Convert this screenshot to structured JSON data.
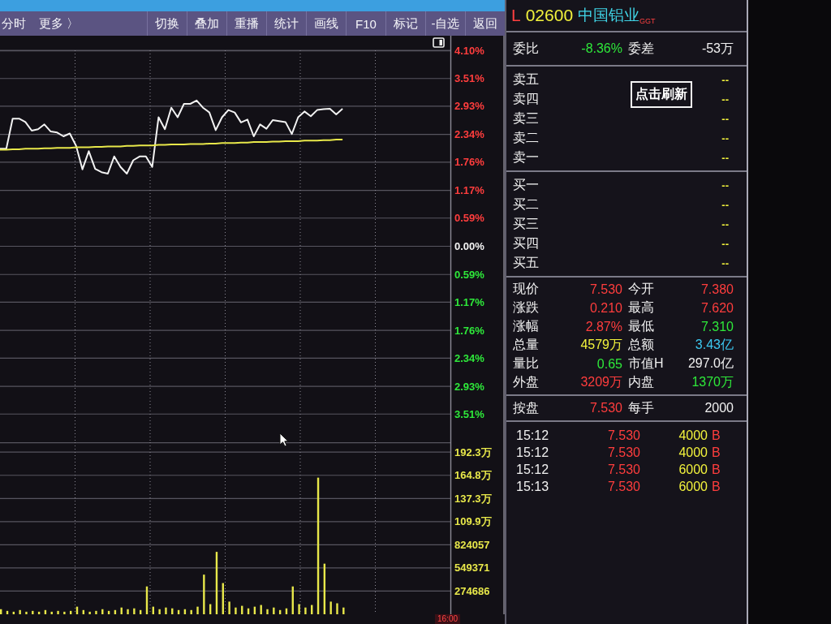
{
  "toolbar": {
    "left_items": [
      "分时",
      "更多 〉"
    ],
    "buttons": [
      "切换",
      "叠加",
      "重播",
      "统计",
      "画线",
      "F10",
      "标记",
      "-自选",
      "返回"
    ]
  },
  "chart_panel": {
    "chart_data": [
      {
        "type": "line",
        "categories": [
          null,
          null,
          null,
          null,
          null,
          null,
          null,
          null,
          null,
          null,
          null,
          null,
          null,
          null,
          null,
          null,
          null,
          null,
          null,
          null,
          null,
          null,
          null,
          null,
          null,
          null,
          null,
          null,
          null,
          null,
          null,
          null,
          null,
          null,
          null,
          null,
          null,
          null,
          null,
          null,
          null,
          null,
          null,
          null,
          null,
          null,
          null,
          null,
          null,
          null,
          null,
          null,
          null,
          null,
          null,
          null,
          null,
          null,
          null,
          null,
          null,
          null,
          null,
          null,
          null,
          null,
          null,
          null,
          null,
          null,
          null,
          null
        ],
        "ylim": [
          -4.1,
          4.1
        ],
        "yticks": [
          {
            "value": 4.1,
            "label": "4.10%"
          },
          {
            "value": 3.51,
            "label": "3.51%"
          },
          {
            "value": 2.93,
            "label": "2.93%"
          },
          {
            "value": 2.34,
            "label": "2.34%"
          },
          {
            "value": 1.76,
            "label": "1.76%"
          },
          {
            "value": 1.17,
            "label": "1.17%"
          },
          {
            "value": 0.59,
            "label": "0.59%"
          },
          {
            "value": 0,
            "label": "0.00%"
          },
          {
            "value": -0.59,
            "label": "0.59%"
          },
          {
            "value": -1.17,
            "label": "1.17%"
          },
          {
            "value": -1.76,
            "label": "1.76%"
          },
          {
            "value": -2.34,
            "label": "2.34%"
          },
          {
            "value": -2.93,
            "label": "2.93%"
          },
          {
            "value": -3.51,
            "label": "3.51%"
          }
        ],
        "grid": true,
        "series": [
          {
            "color": "#f2f2f2",
            "values": [
              2.04,
              2.04,
              2.67,
              2.67,
              2.6,
              2.42,
              2.45,
              2.55,
              2.4,
              2.38,
              2.3,
              2.36,
              2.1,
              1.61,
              1.99,
              1.62,
              1.55,
              1.52,
              1.88,
              1.66,
              1.52,
              1.8,
              1.88,
              1.88,
              1.66,
              2.7,
              2.45,
              2.9,
              2.7,
              2.98,
              2.98,
              3.05,
              2.9,
              2.8,
              2.43,
              2.7,
              2.85,
              2.8,
              2.59,
              2.65,
              2.3,
              2.55,
              2.46,
              2.64,
              2.62,
              2.6,
              2.35,
              2.7,
              2.82,
              2.72,
              2.85,
              2.87,
              2.88,
              2.76,
              2.88,
              null,
              null,
              null,
              null,
              null,
              null,
              null,
              null,
              null,
              null,
              null,
              null,
              null,
              null,
              null,
              null,
              null
            ]
          },
          {
            "color": "#e8e84a",
            "values": [
              2.02,
              2.02,
              2.03,
              2.03,
              2.04,
              2.04,
              2.04,
              2.05,
              2.05,
              2.06,
              2.06,
              2.06,
              2.07,
              2.07,
              2.07,
              2.08,
              2.08,
              2.09,
              2.09,
              2.09,
              2.1,
              2.1,
              2.11,
              2.11,
              2.11,
              2.12,
              2.12,
              2.13,
              2.13,
              2.13,
              2.14,
              2.14,
              2.14,
              2.15,
              2.15,
              2.16,
              2.16,
              2.16,
              2.17,
              2.17,
              2.18,
              2.18,
              2.18,
              2.19,
              2.19,
              2.2,
              2.2,
              2.2,
              2.21,
              2.21,
              2.21,
              2.22,
              2.22,
              2.23,
              2.23,
              null,
              null,
              null,
              null,
              null,
              null,
              null,
              null,
              null,
              null,
              null,
              null,
              null,
              null,
              null,
              null,
              null
            ]
          }
        ]
      },
      {
        "type": "bar",
        "categories": [
          null,
          null,
          null,
          null,
          null,
          null,
          null,
          null,
          null,
          null,
          null,
          null,
          null,
          null,
          null,
          null,
          null,
          null,
          null,
          null,
          null,
          null,
          null,
          null,
          null,
          null,
          null,
          null,
          null,
          null,
          null,
          null,
          null,
          null,
          null,
          null,
          null,
          null,
          null,
          null,
          null,
          null,
          null,
          null,
          null,
          null,
          null,
          null,
          null,
          null,
          null,
          null,
          null,
          null,
          null,
          null,
          null,
          null,
          null,
          null,
          null,
          null,
          null,
          null,
          null,
          null,
          null,
          null,
          null,
          null,
          null,
          null
        ],
        "ylim": [
          0,
          2040000
        ],
        "yticks": [
          274686,
          549371,
          824057
        ],
        "y2lim": [
          0,
          204
        ],
        "y2ticks": [
          {
            "value": 109.9,
            "label": "109.9万"
          },
          {
            "value": 137.3,
            "label": "137.3万"
          },
          {
            "value": 164.8,
            "label": "164.8万"
          },
          {
            "value": 192.3,
            "label": "192.3万"
          }
        ],
        "grid": true,
        "color": "#e8e84a",
        "values": [
          60000,
          40000,
          30000,
          50000,
          30000,
          40000,
          30000,
          50000,
          30000,
          40000,
          30000,
          40000,
          90000,
          50000,
          30000,
          40000,
          60000,
          40000,
          50000,
          80000,
          60000,
          70000,
          50000,
          330000,
          90000,
          60000,
          80000,
          70000,
          50000,
          60000,
          50000,
          90000,
          470000,
          120000,
          740000,
          370000,
          150000,
          80000,
          100000,
          70000,
          90000,
          110000,
          60000,
          80000,
          50000,
          70000,
          330000,
          120000,
          80000,
          110000,
          1620000,
          600000,
          150000,
          130000,
          80000,
          null,
          null,
          null,
          null,
          null,
          null,
          null,
          null,
          null,
          null,
          null,
          null,
          null,
          null,
          null,
          null,
          null
        ]
      }
    ],
    "time_label": "16:00"
  },
  "quote_panel": {
    "header": {
      "market": "L",
      "code": "02600",
      "name": "中国铝业",
      "tag": "GGT"
    },
    "order_ratio": [
      {
        "label": "委比",
        "value": "-8.36%",
        "color": "#2ee83a"
      },
      {
        "label": "委差",
        "value": "-53万",
        "color": "#f0f0f0"
      }
    ],
    "refresh_button": "点击刷新",
    "sell_levels": [
      {
        "label": "卖五",
        "value": "--"
      },
      {
        "label": "卖四",
        "value": "--"
      },
      {
        "label": "卖三",
        "value": "--"
      },
      {
        "label": "卖二",
        "value": "--"
      },
      {
        "label": "卖一",
        "value": "--"
      }
    ],
    "buy_levels": [
      {
        "label": "买一",
        "value": "--"
      },
      {
        "label": "买二",
        "value": "--"
      },
      {
        "label": "买三",
        "value": "--"
      },
      {
        "label": "买四",
        "value": "--"
      },
      {
        "label": "买五",
        "value": "--"
      }
    ],
    "stats": [
      {
        "label": "现价",
        "value": "7.530",
        "color": "#ff3d3d"
      },
      {
        "label": "今开",
        "value": "7.380",
        "color": "#ff3d3d"
      },
      {
        "label": "涨跌",
        "value": "0.210",
        "color": "#ff3d3d"
      },
      {
        "label": "最高",
        "value": "7.620",
        "color": "#ff3d3d"
      },
      {
        "label": "涨幅",
        "value": "2.87%",
        "color": "#ff3d3d"
      },
      {
        "label": "最低",
        "value": "7.310",
        "color": "#2ee83a"
      },
      {
        "label": "总量",
        "value": "4579万",
        "color": "#f2f23c"
      },
      {
        "label": "总额",
        "value": "3.43亿",
        "color": "#3cc8f0"
      },
      {
        "label": "量比",
        "value": "0.65",
        "color": "#2ee83a"
      },
      {
        "label": "市值H",
        "value": "297.0亿",
        "color": "#f0f0f0"
      },
      {
        "label": "外盘",
        "value": "3209万",
        "color": "#ff3d3d"
      },
      {
        "label": "内盘",
        "value": "1370万",
        "color": "#2ee83a"
      }
    ],
    "lot_info": [
      {
        "label": "按盘",
        "value": "7.530",
        "color": "#ff3d3d"
      },
      {
        "label": "每手",
        "value": "2000",
        "color": "#f0f0f0"
      }
    ],
    "trades": [
      {
        "time": "15:12",
        "price": "7.530",
        "volume": "4000",
        "side": "B"
      },
      {
        "time": "15:12",
        "price": "7.530",
        "volume": "4000",
        "side": "B"
      },
      {
        "time": "15:12",
        "price": "7.530",
        "volume": "6000",
        "side": "B"
      },
      {
        "time": "15:13",
        "price": "7.530",
        "volume": "6000",
        "side": "B"
      }
    ]
  }
}
